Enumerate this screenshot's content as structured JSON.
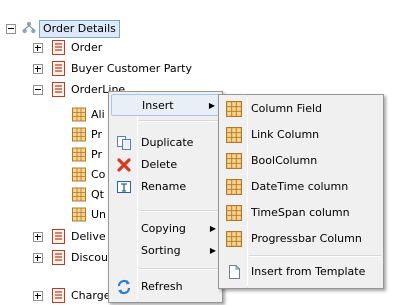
{
  "tree": {
    "root_label": "Order Details",
    "items": [
      {
        "label": "Order"
      },
      {
        "label": "Buyer Customer Party"
      },
      {
        "label": "OrderLine"
      },
      {
        "label": "Ali"
      },
      {
        "label": "Pr"
      },
      {
        "label": "Pr"
      },
      {
        "label": "Co"
      },
      {
        "label": "Qt"
      },
      {
        "label": "Un"
      },
      {
        "label": "Delive"
      },
      {
        "label": "Discou"
      },
      {
        "label": "Charges"
      }
    ]
  },
  "context_menu": {
    "items": [
      {
        "label": "Insert",
        "icon": "none"
      },
      {
        "label": "Duplicate",
        "icon": "copy-icon"
      },
      {
        "label": "Delete",
        "icon": "delete-x-icon"
      },
      {
        "label": "Rename",
        "icon": "rename-icon"
      },
      {
        "label": "Copying",
        "icon": "none"
      },
      {
        "label": "Sorting",
        "icon": "none"
      },
      {
        "label": "Refresh",
        "icon": "refresh-icon"
      }
    ]
  },
  "submenu": {
    "items": [
      {
        "label": "Column Field"
      },
      {
        "label": "Link Column"
      },
      {
        "label": "BoolColumn"
      },
      {
        "label": "DateTime column"
      },
      {
        "label": "TimeSpan column"
      },
      {
        "label": "Progressbar Column"
      },
      {
        "label": "Insert from Template"
      }
    ]
  },
  "colors": {
    "selection": "#dde9f8",
    "menu_bg": "#f0f0f0",
    "hover": "#e8eff7",
    "grid_icon": "#f2a93b"
  }
}
